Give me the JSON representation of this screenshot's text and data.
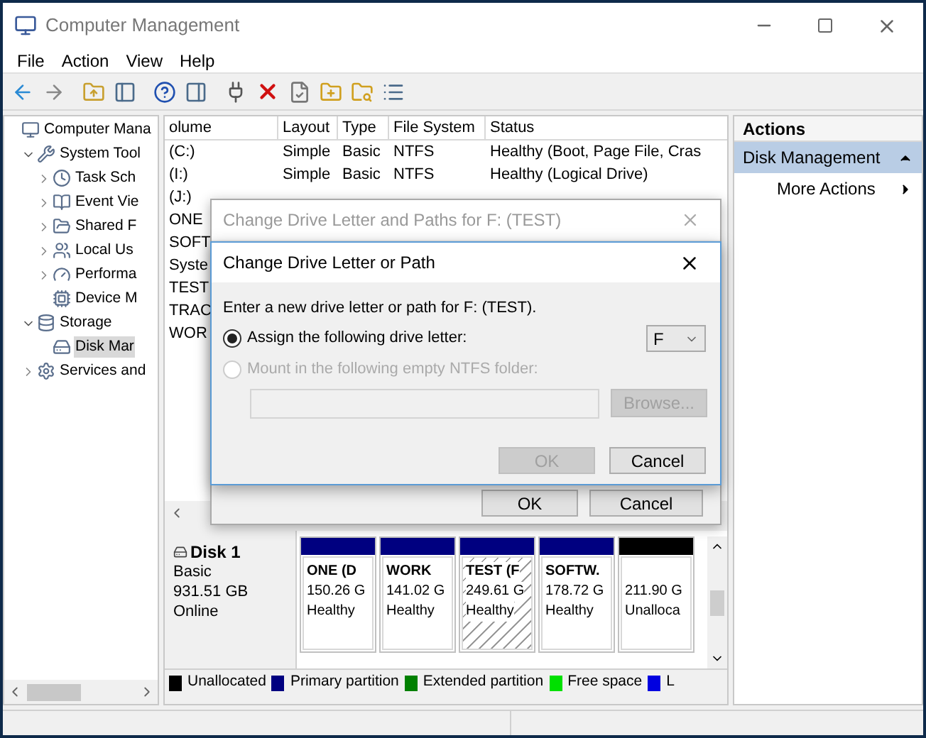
{
  "window": {
    "title": "Computer Management"
  },
  "menu": [
    "File",
    "Action",
    "View",
    "Help"
  ],
  "tree": [
    {
      "label": "Computer Mana",
      "selected": false,
      "children": [
        {
          "label": "System Tool",
          "expanded": true,
          "selected": false,
          "children": [
            {
              "label": "Task Sch",
              "expanded": false,
              "selected": false
            },
            {
              "label": "Event Vie",
              "expanded": false,
              "selected": false
            },
            {
              "label": "Shared F",
              "expanded": false,
              "selected": false
            },
            {
              "label": "Local Us",
              "expanded": false,
              "selected": false
            },
            {
              "label": "Performa",
              "expanded": false,
              "selected": false
            },
            {
              "label": "Device M",
              "selected": false
            }
          ]
        },
        {
          "label": "Storage",
          "expanded": true,
          "selected": false,
          "children": [
            {
              "label": "Disk Mar",
              "selected": true
            }
          ]
        },
        {
          "label": "Services and",
          "expanded": false,
          "selected": false
        }
      ]
    }
  ],
  "table": {
    "columns": [
      "olume",
      "Layout",
      "Type",
      "File System",
      "Status"
    ],
    "rows": [
      {
        "volume": "(C:)",
        "layout": "Simple",
        "type": "Basic",
        "file_system": "NTFS",
        "status": "Healthy (Boot, Page File, Cras"
      },
      {
        "volume": "(I:)",
        "layout": "Simple",
        "type": "Basic",
        "file_system": "NTFS",
        "status": "Healthy (Logical Drive)"
      },
      {
        "volume": "(J:)"
      },
      {
        "volume": "ONE"
      },
      {
        "volume": "SOFT"
      },
      {
        "volume": "Syste"
      },
      {
        "volume": "TEST"
      },
      {
        "volume": "TRAC"
      },
      {
        "volume": "WOR"
      }
    ]
  },
  "disk": {
    "name": "Disk 1",
    "type": "Basic",
    "size": "931.51 GB",
    "state": "Online",
    "partitions": [
      {
        "name": "ONE (D",
        "size": "150.26 G",
        "status": "Healthy",
        "color": "#000080",
        "selected": false
      },
      {
        "name": "WORK",
        "size": "141.02 G",
        "status": "Healthy",
        "color": "#000080",
        "selected": false
      },
      {
        "name": "TEST (F",
        "size": "249.61 G",
        "status": "Healthy",
        "color": "#000080",
        "selected": true
      },
      {
        "name": "SOFTW.",
        "size": "178.72 G",
        "status": "Healthy",
        "color": "#000080",
        "selected": false
      },
      {
        "size": "211.90 G",
        "status": "Unalloca",
        "color": "#000000",
        "selected": false
      }
    ]
  },
  "legend": [
    {
      "label": "Unallocated",
      "color": "#000000"
    },
    {
      "label": "Primary partition",
      "color": "#000080"
    },
    {
      "label": "Extended partition",
      "color": "#008000"
    },
    {
      "label": "Free space",
      "color": "#00e000"
    },
    {
      "label": "L",
      "color": "#0000e0"
    }
  ],
  "actions": {
    "title": "Actions",
    "items": [
      {
        "label": "Disk Management",
        "selected": true
      },
      {
        "label": "More Actions",
        "selected": false
      }
    ]
  },
  "outer_dialog": {
    "title": "Change Drive Letter and Paths for F: (TEST)",
    "ok": "OK",
    "cancel": "Cancel"
  },
  "dialog": {
    "title": "Change Drive Letter or Path",
    "prompt": "Enter a new drive letter or path for F: (TEST).",
    "options": [
      {
        "label": "Assign the following drive letter:",
        "selected": true,
        "disabled": false
      },
      {
        "label": "Mount in the following empty NTFS folder:",
        "selected": false,
        "disabled": true
      }
    ],
    "letter": "F",
    "browse": {
      "label": "Browse...",
      "disabled": true
    },
    "ok": {
      "label": "OK",
      "disabled": true
    },
    "cancel": {
      "label": "Cancel",
      "disabled": false
    }
  }
}
